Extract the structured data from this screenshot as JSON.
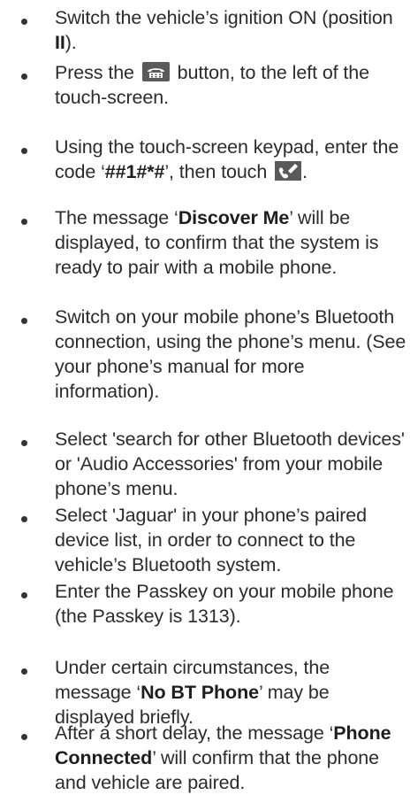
{
  "instructions": {
    "items": [
      {
        "parts": [
          {
            "text": "Switch the vehicle’s ignition ON (position ",
            "bold": false
          },
          {
            "text": "II",
            "bold": true
          },
          {
            "text": ").",
            "bold": false
          }
        ]
      },
      {
        "parts": [
          {
            "text": "Press the ",
            "bold": false
          },
          {
            "icon": "phone-menu-icon"
          },
          {
            "text": " button, to the left of the touch-screen.",
            "bold": false
          }
        ]
      },
      {
        "parts": [
          {
            "text": "Using the touch-screen keypad, enter the code ‘",
            "bold": false
          },
          {
            "text": "##1#*#",
            "bold": true
          },
          {
            "text": "’, then touch ",
            "bold": false
          },
          {
            "icon": "call-handset-icon"
          },
          {
            "text": ".",
            "bold": false
          }
        ]
      },
      {
        "parts": [
          {
            "text": "The message ‘",
            "bold": false
          },
          {
            "text": "Discover Me",
            "bold": true
          },
          {
            "text": "’ will be displayed, to confirm that the system is ready to pair with a mobile phone.",
            "bold": false
          }
        ]
      },
      {
        "parts": [
          {
            "text": "Switch on your mobile phone’s Bluetooth connection, using the phone’s menu. (See your phone’s manual for more information).",
            "bold": false
          }
        ]
      },
      {
        "parts": [
          {
            "text": "Select 'search for other Bluetooth devices' or 'Audio Accessories' from your mobile phone’s menu.",
            "bold": false
          }
        ]
      },
      {
        "parts": [
          {
            "text": "Select 'Jaguar' in your phone’s paired device list, in order to connect to the vehicle’s Bluetooth system.",
            "bold": false
          }
        ]
      },
      {
        "parts": [
          {
            "text": "Enter the Passkey on your mobile phone (the Passkey is 1313).",
            "bold": false
          }
        ]
      },
      {
        "parts": [
          {
            "text": "Under certain circumstances, the message ‘",
            "bold": false
          },
          {
            "text": "No BT Phone",
            "bold": true
          },
          {
            "text": "’ may be displayed briefly.",
            "bold": false
          }
        ]
      },
      {
        "parts": [
          {
            "text": "After a short delay, the message ‘",
            "bold": false
          },
          {
            "text": "Phone Connected",
            "bold": true
          },
          {
            "text": "’ will confirm that the phone and vehicle are paired.",
            "bold": false
          }
        ]
      }
    ]
  }
}
